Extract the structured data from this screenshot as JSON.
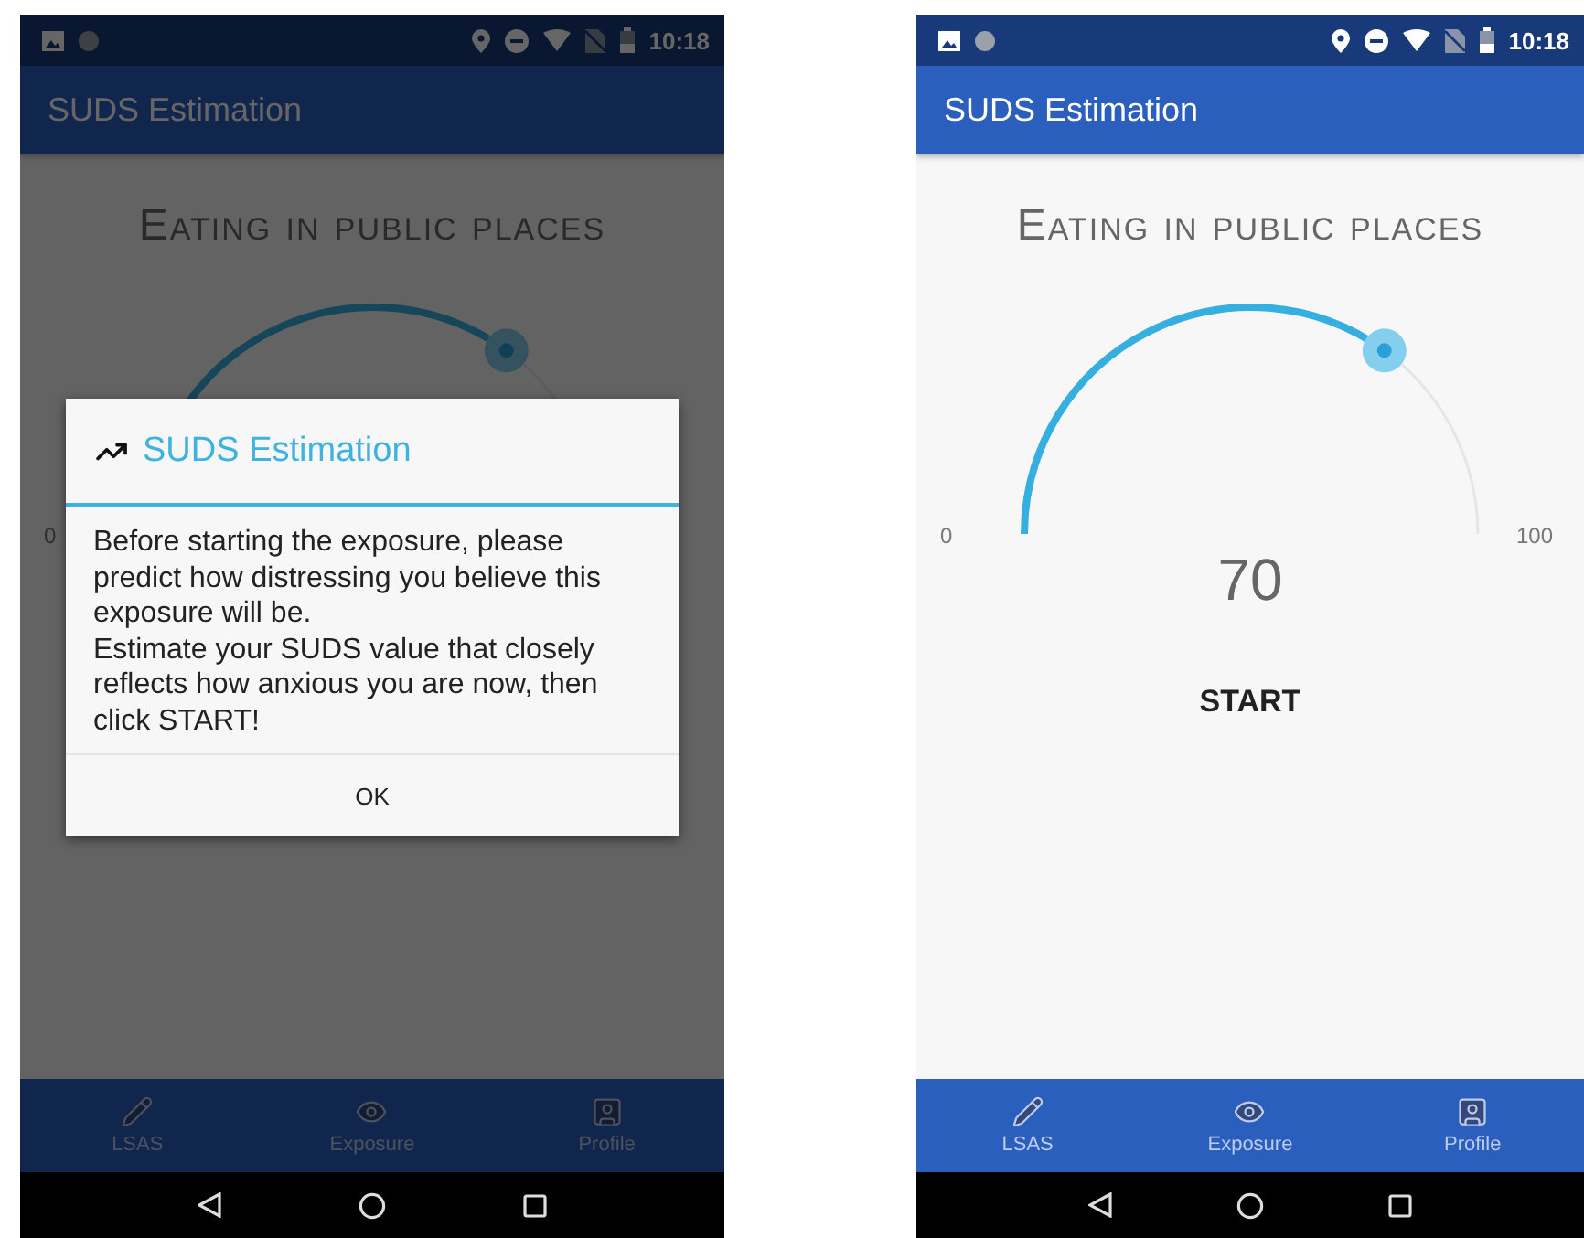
{
  "screens": [
    {
      "status_time": "10:18",
      "title": "SUDS Estimation",
      "heading": "Eating in public places",
      "gauge": {
        "min_label": "0"
      },
      "nav": [
        {
          "kind": "pencil",
          "label": "LSAS"
        },
        {
          "kind": "eye",
          "label": "Exposure"
        },
        {
          "kind": "person",
          "label": "Profile"
        }
      ],
      "dialog": {
        "title": "SUDS Estimation",
        "message": "Before starting the exposure, please predict how distressing you believe this exposure will be.\nEstimate your SUDS value that closely reflects how anxious you are now, then click START!",
        "button": "OK"
      }
    },
    {
      "status_time": "10:18",
      "title": "SUDS Estimation",
      "heading": "Eating in public places",
      "gauge": {
        "min_label": "0",
        "max_label": "100",
        "value": "70"
      },
      "start": "START",
      "nav": [
        {
          "kind": "pencil",
          "label": "LSAS"
        },
        {
          "kind": "eye",
          "label": "Exposure"
        },
        {
          "kind": "person",
          "label": "Profile"
        }
      ]
    }
  ]
}
